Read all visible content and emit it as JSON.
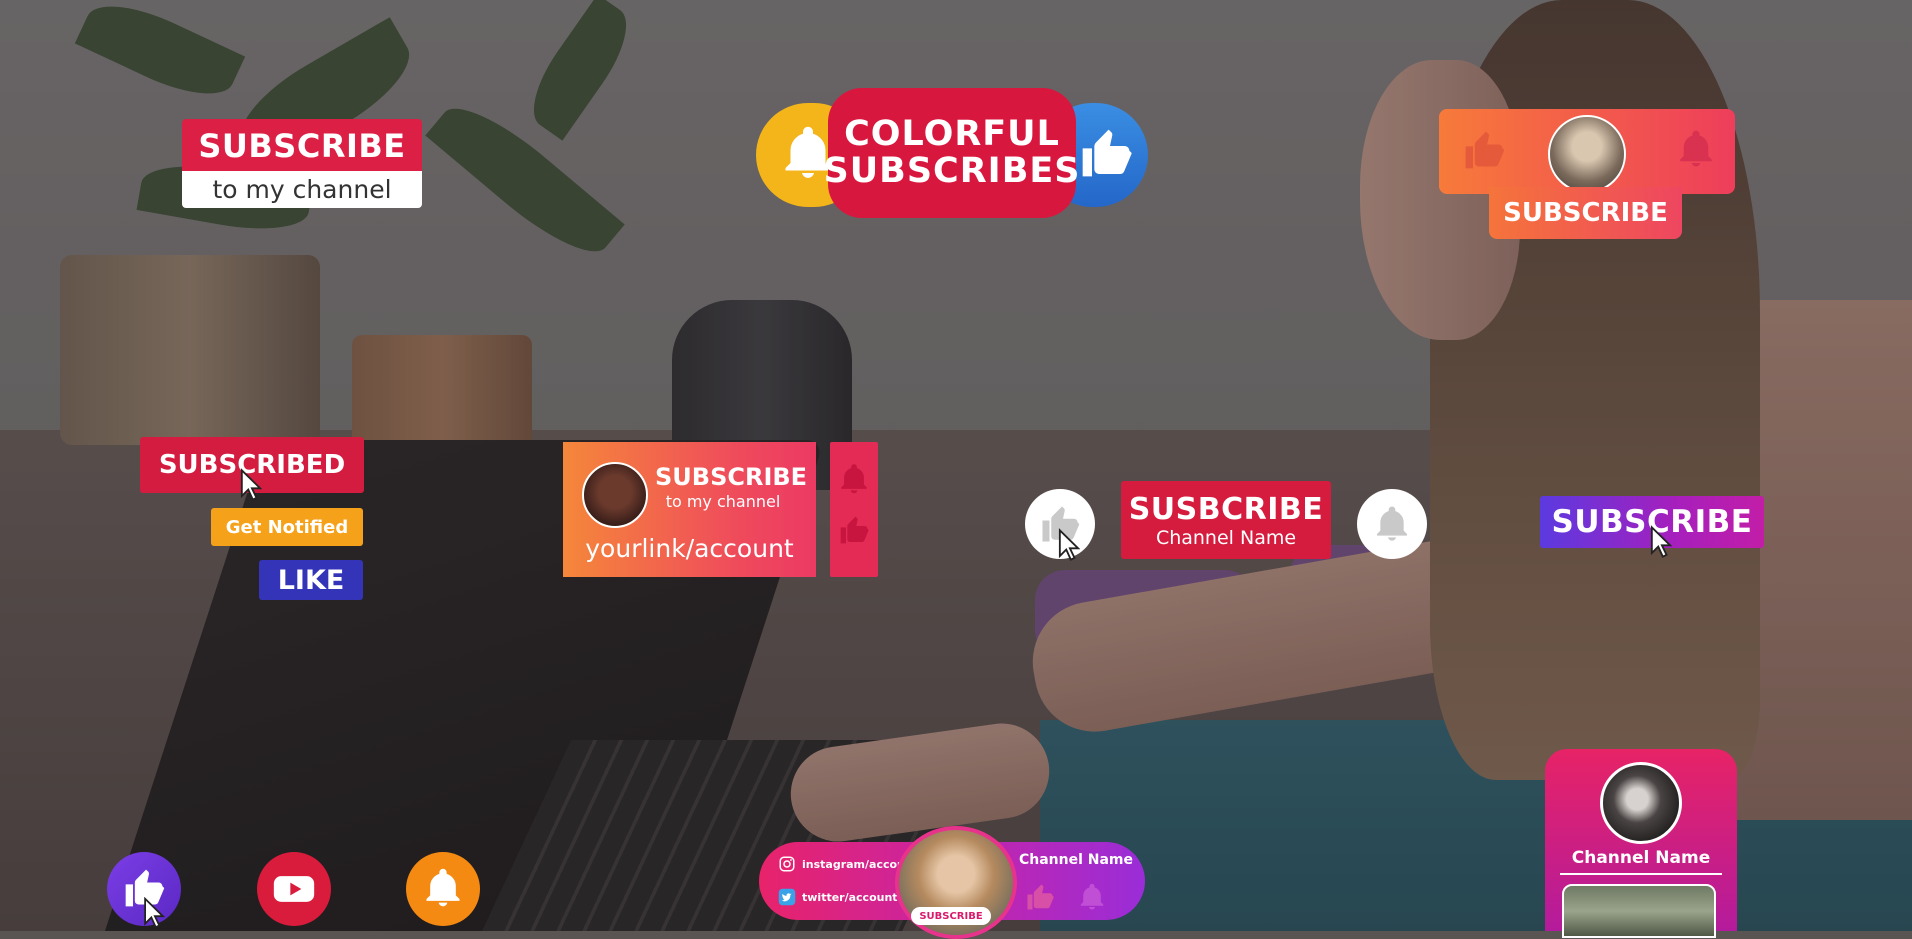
{
  "widgets": {
    "subscribe_channel": {
      "title": "SUBSCRIBE",
      "subtitle": "to my channel"
    },
    "colorful": {
      "line1": "COLORFUL",
      "line2": "SUBSCRIBES"
    },
    "avatar_subscribe": {
      "label": "SUBSCRIBE"
    },
    "stack": {
      "subscribed": "SUBSCRIBED",
      "notified": "Get Notified",
      "like": "LIKE"
    },
    "card": {
      "title": "SUBSCRIBE",
      "subtitle": "to my channel",
      "link": "yourlink/account"
    },
    "channel": {
      "title": "SUSBCRIBE",
      "subtitle": "Channel Name"
    },
    "purple": {
      "label": "SUBSCRIBE"
    },
    "social": {
      "instagram": "instagram/account",
      "twitter": "twitter/account",
      "tag": "SUBSCRIBE",
      "name": "Channel Name"
    },
    "profile": {
      "name": "Channel Name"
    }
  },
  "colors": {
    "red": "#dc1f45",
    "orange": "#f5a21a",
    "blue": "#3434b9",
    "purple": "#7b3ee6",
    "magenta": "#c724a6"
  },
  "icons": [
    "bell-icon",
    "thumbs-up-icon",
    "youtube-icon",
    "cursor-icon",
    "instagram-icon",
    "twitter-icon"
  ]
}
